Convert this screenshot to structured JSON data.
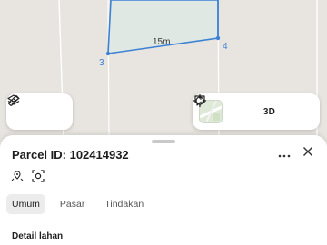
{
  "map": {
    "edge_label": "15m",
    "vertex_labels": [
      "3",
      "4"
    ],
    "parcel_fill": "#dfe8e2",
    "parcel_stroke": "#3b82d6"
  },
  "map_controls": {
    "left": [
      "layers-icon",
      "measure-icon"
    ],
    "right": [
      "basemap-thumbnail",
      "locate-icon",
      "3d-button",
      "feedback-icon"
    ],
    "label_3d": "3D"
  },
  "sheet": {
    "title": "Parcel ID: 102414932",
    "tabs": [
      {
        "label": "Umum",
        "active": true
      },
      {
        "label": "Pasar",
        "active": false
      },
      {
        "label": "Tindakan",
        "active": false
      }
    ],
    "section_title": "Detail lahan"
  }
}
